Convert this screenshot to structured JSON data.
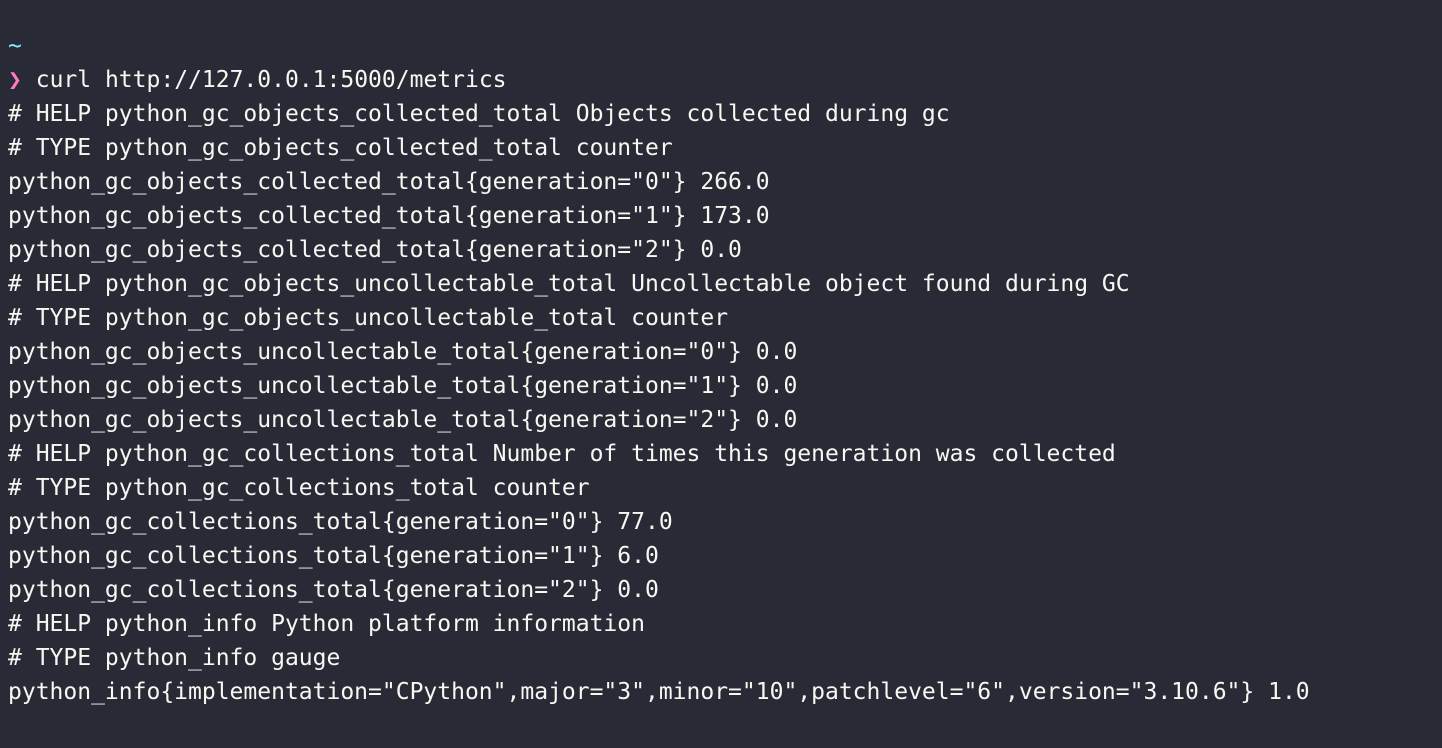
{
  "terminal": {
    "cwd": "~",
    "prompt_symbol": "❯",
    "command": "curl http://127.0.0.1:5000/metrics",
    "output": [
      "# HELP python_gc_objects_collected_total Objects collected during gc",
      "# TYPE python_gc_objects_collected_total counter",
      "python_gc_objects_collected_total{generation=\"0\"} 266.0",
      "python_gc_objects_collected_total{generation=\"1\"} 173.0",
      "python_gc_objects_collected_total{generation=\"2\"} 0.0",
      "# HELP python_gc_objects_uncollectable_total Uncollectable object found during GC",
      "# TYPE python_gc_objects_uncollectable_total counter",
      "python_gc_objects_uncollectable_total{generation=\"0\"} 0.0",
      "python_gc_objects_uncollectable_total{generation=\"1\"} 0.0",
      "python_gc_objects_uncollectable_total{generation=\"2\"} 0.0",
      "# HELP python_gc_collections_total Number of times this generation was collected",
      "# TYPE python_gc_collections_total counter",
      "python_gc_collections_total{generation=\"0\"} 77.0",
      "python_gc_collections_total{generation=\"1\"} 6.0",
      "python_gc_collections_total{generation=\"2\"} 0.0",
      "# HELP python_info Python platform information",
      "# TYPE python_info gauge",
      "python_info{implementation=\"CPython\",major=\"3\",minor=\"10\",patchlevel=\"6\",version=\"3.10.6\"} 1.0"
    ],
    "colors": {
      "background": "#282a36",
      "foreground": "#f8f8f2",
      "cwd": "#8be9fd",
      "prompt": "#ff79c6"
    }
  }
}
